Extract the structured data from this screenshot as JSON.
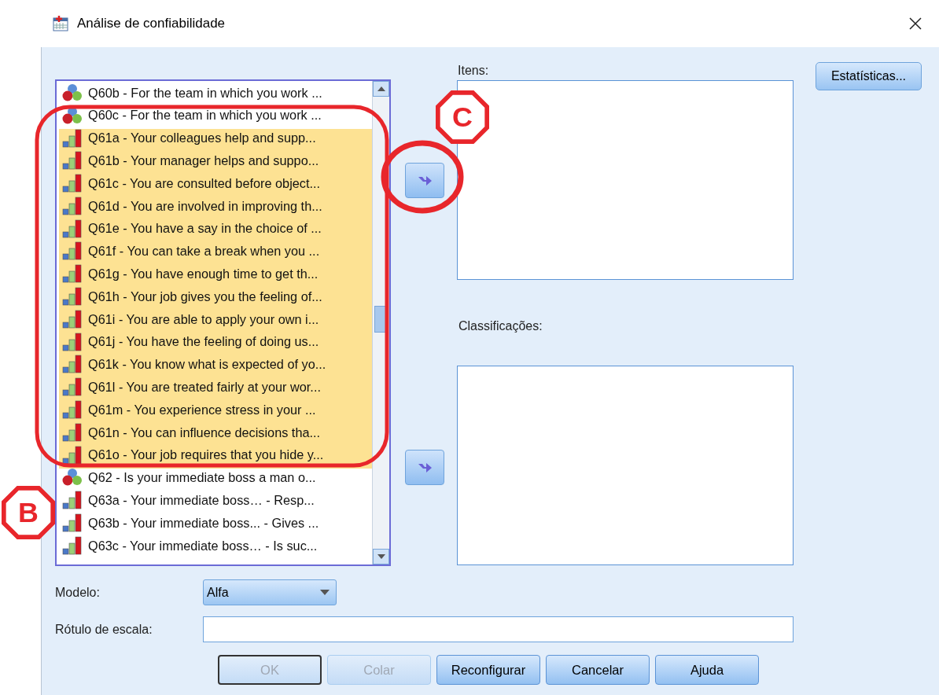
{
  "window": {
    "title": "Análise de confiabilidade"
  },
  "variables": [
    {
      "label": "Q60b - For the team in which you work ...",
      "kind": "nominal",
      "selected": false
    },
    {
      "label": "Q60c - For the team in which you work ...",
      "kind": "nominal",
      "selected": false
    },
    {
      "label": "Q61a - Your colleagues help and supp...",
      "kind": "ordinal",
      "selected": true
    },
    {
      "label": "Q61b - Your manager helps and suppo...",
      "kind": "ordinal",
      "selected": true
    },
    {
      "label": "Q61c - You are consulted before object...",
      "kind": "ordinal",
      "selected": true
    },
    {
      "label": "Q61d - You are involved in improving th...",
      "kind": "ordinal",
      "selected": true
    },
    {
      "label": "Q61e - You have a say in the choice of ...",
      "kind": "ordinal",
      "selected": true
    },
    {
      "label": "Q61f - You can take a break when you ...",
      "kind": "ordinal",
      "selected": true
    },
    {
      "label": "Q61g - You have enough time to get th...",
      "kind": "ordinal",
      "selected": true
    },
    {
      "label": "Q61h - Your job gives you the feeling of...",
      "kind": "ordinal",
      "selected": true
    },
    {
      "label": "Q61i - You are able to apply your own i...",
      "kind": "ordinal",
      "selected": true
    },
    {
      "label": "Q61j - You have the feeling of doing us...",
      "kind": "ordinal",
      "selected": true
    },
    {
      "label": "Q61k - You know what is expected of yo...",
      "kind": "ordinal",
      "selected": true
    },
    {
      "label": "Q61l - You are treated fairly at your wor...",
      "kind": "ordinal",
      "selected": true
    },
    {
      "label": "Q61m - You experience stress in your ...",
      "kind": "ordinal",
      "selected": true
    },
    {
      "label": "Q61n - You can influence decisions tha...",
      "kind": "ordinal",
      "selected": true
    },
    {
      "label": "Q61o - Your job requires that you hide y...",
      "kind": "ordinal",
      "selected": true
    },
    {
      "label": "Q62 - Is your immediate boss a man o...",
      "kind": "nominal",
      "selected": false
    },
    {
      "label": "Q63a - Your immediate boss… - Resp...",
      "kind": "ordinal",
      "selected": false
    },
    {
      "label": "Q63b - Your immediate boss... - Gives ...",
      "kind": "ordinal",
      "selected": false
    },
    {
      "label": "Q63c - Your immediate boss… - Is suc...",
      "kind": "ordinal",
      "selected": false
    }
  ],
  "items": {
    "label": "Itens:"
  },
  "classifications": {
    "label": "Classificações:"
  },
  "statistics_button": "Estatísticas...",
  "model": {
    "label": "Modelo:",
    "value": "Alfa"
  },
  "scale_label": {
    "label": "Rótulo de escala:"
  },
  "buttons": [
    {
      "label": "OK",
      "disabled": true,
      "default": true
    },
    {
      "label": "Colar",
      "disabled": true,
      "default": false
    },
    {
      "label": "Reconfigurar",
      "disabled": false,
      "default": false
    },
    {
      "label": "Cancelar",
      "disabled": false,
      "default": false
    },
    {
      "label": "Ajuda",
      "disabled": false,
      "default": false
    }
  ],
  "annotations": [
    {
      "kind": "outline"
    },
    {
      "kind": "circle"
    },
    {
      "kind": "badge",
      "label": "C"
    },
    {
      "kind": "badge",
      "label": "B"
    }
  ]
}
